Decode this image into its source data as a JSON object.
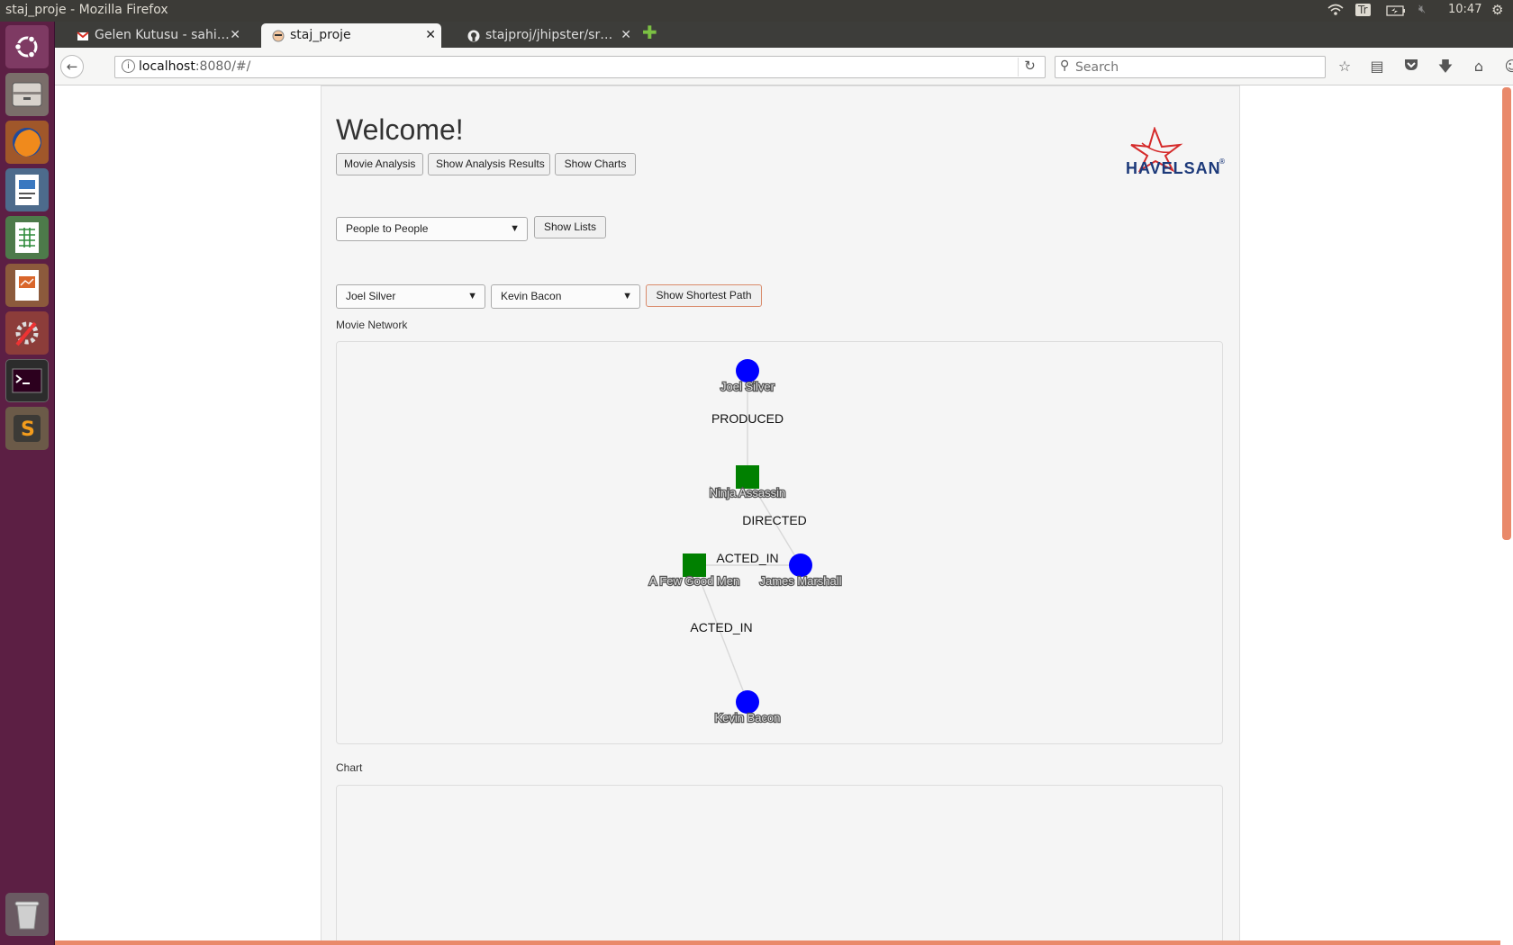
{
  "os": {
    "window_title": "staj_proje - Mozilla Firefox",
    "keyboard_layout": "Tr",
    "clock": "10:47"
  },
  "browser": {
    "tabs": [
      {
        "label": "Gelen Kutusu - sahi…",
        "icon": "gmail-icon"
      },
      {
        "label": "staj_proje",
        "icon": "jhipster-icon"
      },
      {
        "label": "stajproj/jhipster/sr…",
        "icon": "github-icon"
      }
    ],
    "url_host": "localhost",
    "url_rest": ":8080/#/",
    "search_placeholder": "Search"
  },
  "page": {
    "heading": "Welcome!",
    "logo_text": "HAVELSAN",
    "logo_mark": "®",
    "nav_buttons": [
      "Movie Analysis",
      "Show Analysis Results",
      "Show Charts"
    ],
    "mode_select": "People to People",
    "show_lists_label": "Show Lists",
    "from_select": "Joel Silver",
    "to_select": "Kevin Bacon",
    "shortest_path_label": "Show Shortest Path",
    "network_title": "Movie Network",
    "chart_title": "Chart"
  },
  "network": {
    "colors": {
      "person": "#0000ff",
      "movie": "#008000",
      "edge": "#d8d8d8"
    },
    "nodes": [
      {
        "id": "joel",
        "label": "Joel Silver",
        "kind": "person"
      },
      {
        "id": "ninja",
        "label": "Ninja Assassin",
        "kind": "movie"
      },
      {
        "id": "fgm",
        "label": "A Few Good Men",
        "kind": "movie"
      },
      {
        "id": "james",
        "label": "James Marshall",
        "kind": "person"
      },
      {
        "id": "kevin",
        "label": "Kevin Bacon",
        "kind": "person"
      }
    ],
    "edges": [
      {
        "from": "joel",
        "to": "ninja",
        "label": "PRODUCED"
      },
      {
        "from": "ninja",
        "to": "james",
        "label": "DIRECTED"
      },
      {
        "from": "james",
        "to": "fgm",
        "label": "ACTED_IN"
      },
      {
        "from": "fgm",
        "to": "kevin",
        "label": "ACTED_IN"
      }
    ]
  }
}
